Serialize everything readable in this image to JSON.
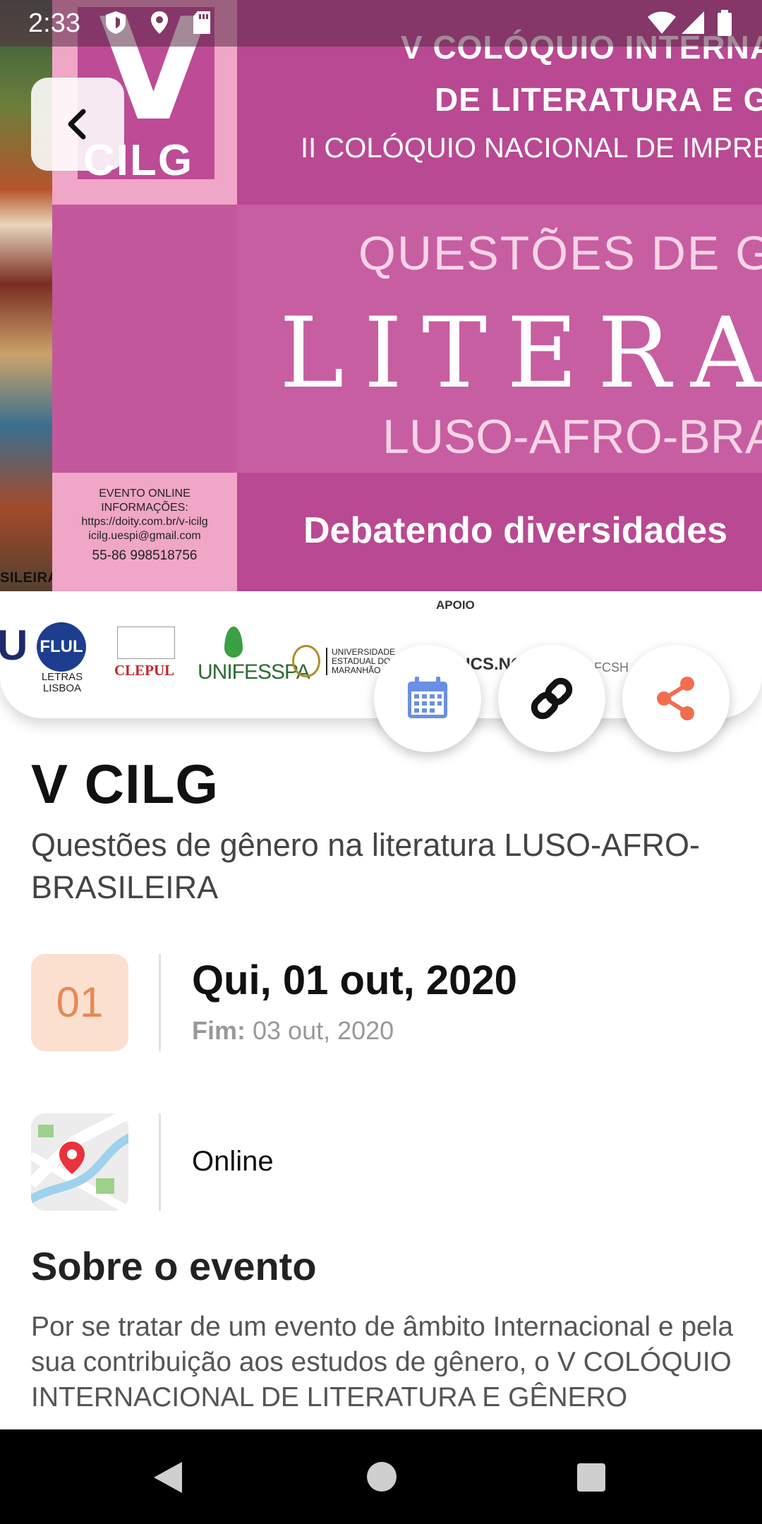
{
  "status_bar": {
    "time": "2:33"
  },
  "banner": {
    "line1": "V COLÓQUIO INTERNACIONAL",
    "line2": "DE LITERATURA E GÊNERO",
    "line3": "II COLÓQUIO NACIONAL DE IMPRENSA",
    "line4": "QUESTÕES DE GÊNERO NA",
    "line5": "LITERATURA",
    "line6": "LUSO-AFRO-BRASILEIRA",
    "line7": "Debatendo diversidades",
    "logo_v": "V",
    "logo_cilg": "CILG",
    "painting_caption": "SILEIRA",
    "info_lines": [
      "EVENTO ONLINE",
      "INFORMAÇÕES:",
      "https://doity.com.br/v-icilg",
      "icilg.uespi@gmail.com"
    ],
    "info_phone": "55-86 998518756"
  },
  "sponsors": {
    "apoio_label": "APOIO",
    "flul": "FLUL",
    "flul_sub": "LETRAS LISBOA",
    "clepul": "CLEPUL",
    "unifesspa": "UNIFESSPA",
    "uema": "UNIVERSIDADE ESTADUAL DO MARANHÃO",
    "ics": "ICS.NO",
    "fcsh": "FCSH",
    "left_letter": "U"
  },
  "event": {
    "title": "V CILG",
    "subtitle": "Questões de gênero na literatura LUSO-AFRO-BRASILEIRA",
    "date_day": "01",
    "date_full": "Qui, 01 out, 2020",
    "end_label": "Fim:",
    "end_date": "03 out, 2020",
    "location": "Online",
    "about_title": "Sobre o evento",
    "about_text": "Por se tratar de um evento de âmbito Internacional e pela sua contribuição aos estudos de gênero, o V COLÓQUIO INTERNACIONAL DE LITERATURA E GÊNERO"
  },
  "icons": {
    "back": "chevron-left-icon",
    "calendar": "calendar-icon",
    "link": "link-icon",
    "share": "share-icon",
    "map": "map-pin-icon"
  },
  "colors": {
    "accent_orange": "#e58a54",
    "badge_bg": "#fbe0d0",
    "calendar_blue": "#6b8fe6",
    "share_orange": "#f26d4f",
    "banner_pink": "#c2589b"
  }
}
